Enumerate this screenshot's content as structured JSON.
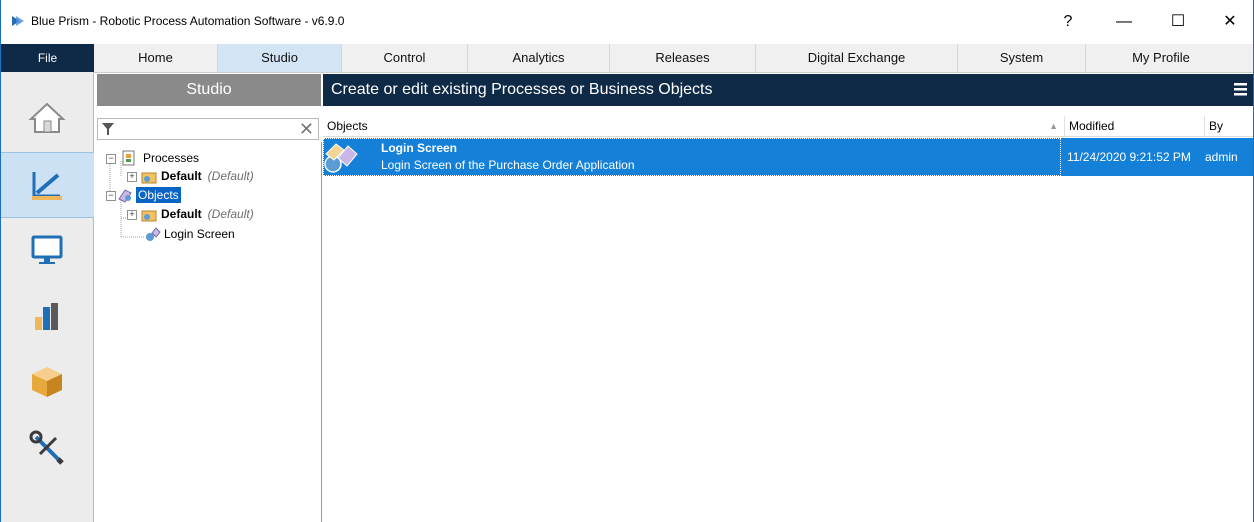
{
  "window": {
    "title": "Blue Prism - Robotic Process Automation Software - v6.9.0",
    "help": "?",
    "minimize": "—",
    "maximize": "☐",
    "close": "✕"
  },
  "menu": {
    "file": "File",
    "tabs": [
      {
        "label": "Home"
      },
      {
        "label": "Studio"
      },
      {
        "label": "Control"
      },
      {
        "label": "Analytics"
      },
      {
        "label": "Releases"
      },
      {
        "label": "Digital Exchange"
      },
      {
        "label": "System"
      },
      {
        "label": "My Profile"
      }
    ],
    "active_tab": "Studio"
  },
  "sidebar": {
    "items": [
      {
        "name": "home-icon"
      },
      {
        "name": "studio-icon",
        "active": true
      },
      {
        "name": "control-monitor-icon"
      },
      {
        "name": "analytics-bar-icon"
      },
      {
        "name": "releases-box-icon"
      },
      {
        "name": "system-tools-icon"
      }
    ]
  },
  "studio_panel": {
    "header": "Studio",
    "filter": {
      "value": "",
      "placeholder": "",
      "clear": "✕"
    },
    "tree": {
      "processes": {
        "label": "Processes",
        "children": [
          {
            "label": "Default",
            "note": "(Default)"
          }
        ]
      },
      "objects": {
        "label": "Objects",
        "children": [
          {
            "label": "Default",
            "note": "(Default)"
          },
          {
            "label": "Login Screen"
          }
        ]
      }
    }
  },
  "main": {
    "header": "Create or edit existing Processes or Business Objects",
    "columns": [
      {
        "label": "Objects"
      },
      {
        "label": "Modified"
      },
      {
        "label": "By"
      }
    ],
    "sort_indicator": "▲",
    "rows": [
      {
        "name": "Login Screen",
        "description": "Login Screen of the Purchase Order Application",
        "modified": "11/24/2020 9:21:52 PM",
        "by": "admin"
      }
    ]
  },
  "colors": {
    "accent_dark": "#0f2a47",
    "selection": "#1480d8",
    "tab_active": "#d3e4f5"
  }
}
